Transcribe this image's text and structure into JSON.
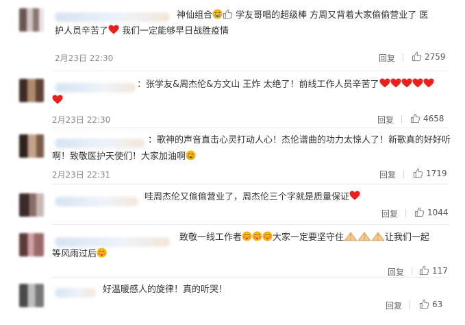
{
  "comments": [
    {
      "lines": [
        "神仙组合",
        "学友哥唱的超级棒 方周又背着大家偷偷营业了 医",
        "护人员辛苦了",
        "我们一定能够早日战胜疫情"
      ],
      "time": "2月23日 22:30",
      "reply": "回复",
      "likes": "2759"
    },
    {
      "lines": [
        "：张学友&周杰伦&方文山 王炸 太绝了！前线工作人员辛苦了"
      ],
      "time": "2月23日 22:30",
      "reply": "回复",
      "likes": "4658"
    },
    {
      "lines": [
        "：歌神的声音直击心灵打动人心！杰伦谱曲的功力太惊人了！新歌真的好好听",
        "啊！致敬医护天使们！大家加油啊"
      ],
      "time": "2月23日 22:31",
      "reply": "回复",
      "likes": "1719"
    },
    {
      "lines": [
        "哇周杰伦又偷偷营业了，周杰伦三个字就是质量保证"
      ],
      "reply": "回复",
      "likes": "1044"
    },
    {
      "lines": [
        "致敬一线工作者",
        "大家一定要坚守住",
        "让我们一起",
        "等风雨过后"
      ],
      "reply": "回复",
      "likes": "117"
    },
    {
      "lines": [
        "好温暖感人的旋律！真的听哭！"
      ],
      "reply": "回复",
      "likes": "63"
    }
  ],
  "icons": {
    "like": "thumbs-up-icon",
    "heart": "red-heart-emoji",
    "cry": "crying-emoji",
    "blush": "blushing-emoji",
    "pray": "praying-hands-emoji"
  },
  "colors": {
    "heart": "#e8211d",
    "emoji": "#f5b60e",
    "text": "#333333",
    "meta": "#8a8a8a"
  }
}
